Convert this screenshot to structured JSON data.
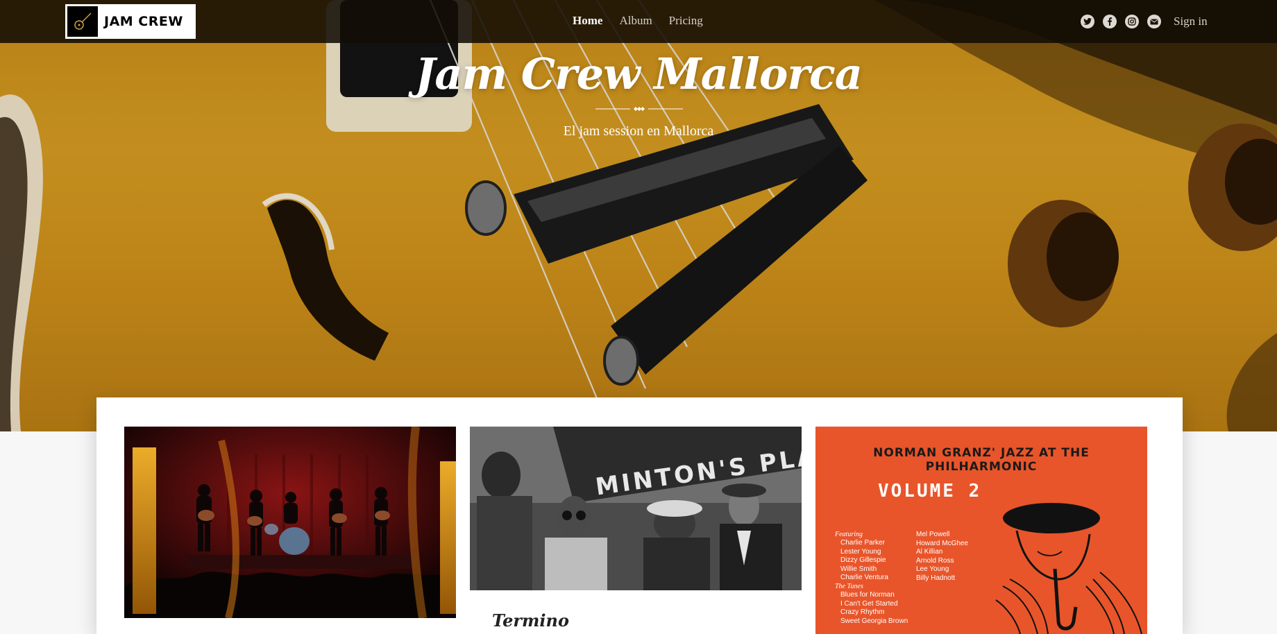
{
  "navbar": {
    "brand": "JAM CREW",
    "links": [
      "Home",
      "Album",
      "Pricing"
    ],
    "active_link": "Home",
    "social_icons": [
      "twitter-icon",
      "facebook-icon",
      "instagram-icon",
      "mail-icon"
    ],
    "signin": "Sign in"
  },
  "hero": {
    "title": "Jam Crew Mallorca",
    "subtitle": "El jam session en Mallorca"
  },
  "cards": [
    {
      "image": "band-stage-photo",
      "title": ""
    },
    {
      "image": "mintons-playhouse-photo",
      "sign_text": "MINTON'S PLAY",
      "title": "Termino"
    },
    {
      "image": "jazz-album-cover",
      "cover_title": "NORMAN GRANZ' JAZZ AT THE PHILHARMONIC",
      "cover_volume": "VOLUME 2",
      "featuring_label": "Featuring",
      "featuring_left": [
        "Charlie Parker",
        "Lester Young",
        "Dizzy Gillespie",
        "Willie Smith",
        "Charlie Ventura"
      ],
      "featuring_right": [
        "Mel Powell",
        "Howard McGhee",
        "Al Killian",
        "Arnold Ross",
        "Lee Young",
        "Billy Hadnott"
      ],
      "tunes_label": "The Tunes",
      "tunes": [
        "Blues for Norman",
        "I Can't Get Started",
        "Crazy Rhythm",
        "Sweet Georgia Brown"
      ]
    }
  ],
  "colors": {
    "navbar_bg": "#120c04",
    "hero_yellow": "#d49b22",
    "album_orange": "#e8552a"
  }
}
